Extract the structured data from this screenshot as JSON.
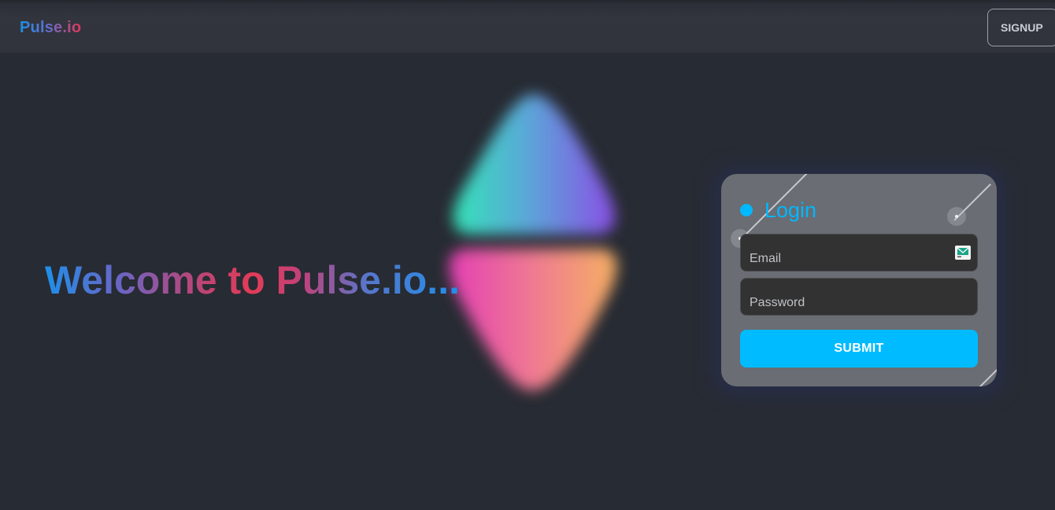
{
  "navbar": {
    "brand": "Pulse.io",
    "signup_label": "SIGNUP"
  },
  "hero": {
    "title": "Welcome to Pulse.io..."
  },
  "login": {
    "title": "Login",
    "email_label": "Email",
    "password_label": "Password",
    "submit_label": "SUBMIT",
    "email_icon": "mail-icon"
  },
  "colors": {
    "background": "#272b33",
    "navbar": "#32353d",
    "card": "#6a6d73",
    "field": "#323232",
    "accent": "#00bbff",
    "brand_blue": "#1e8ee6",
    "brand_red": "#e0375a"
  }
}
